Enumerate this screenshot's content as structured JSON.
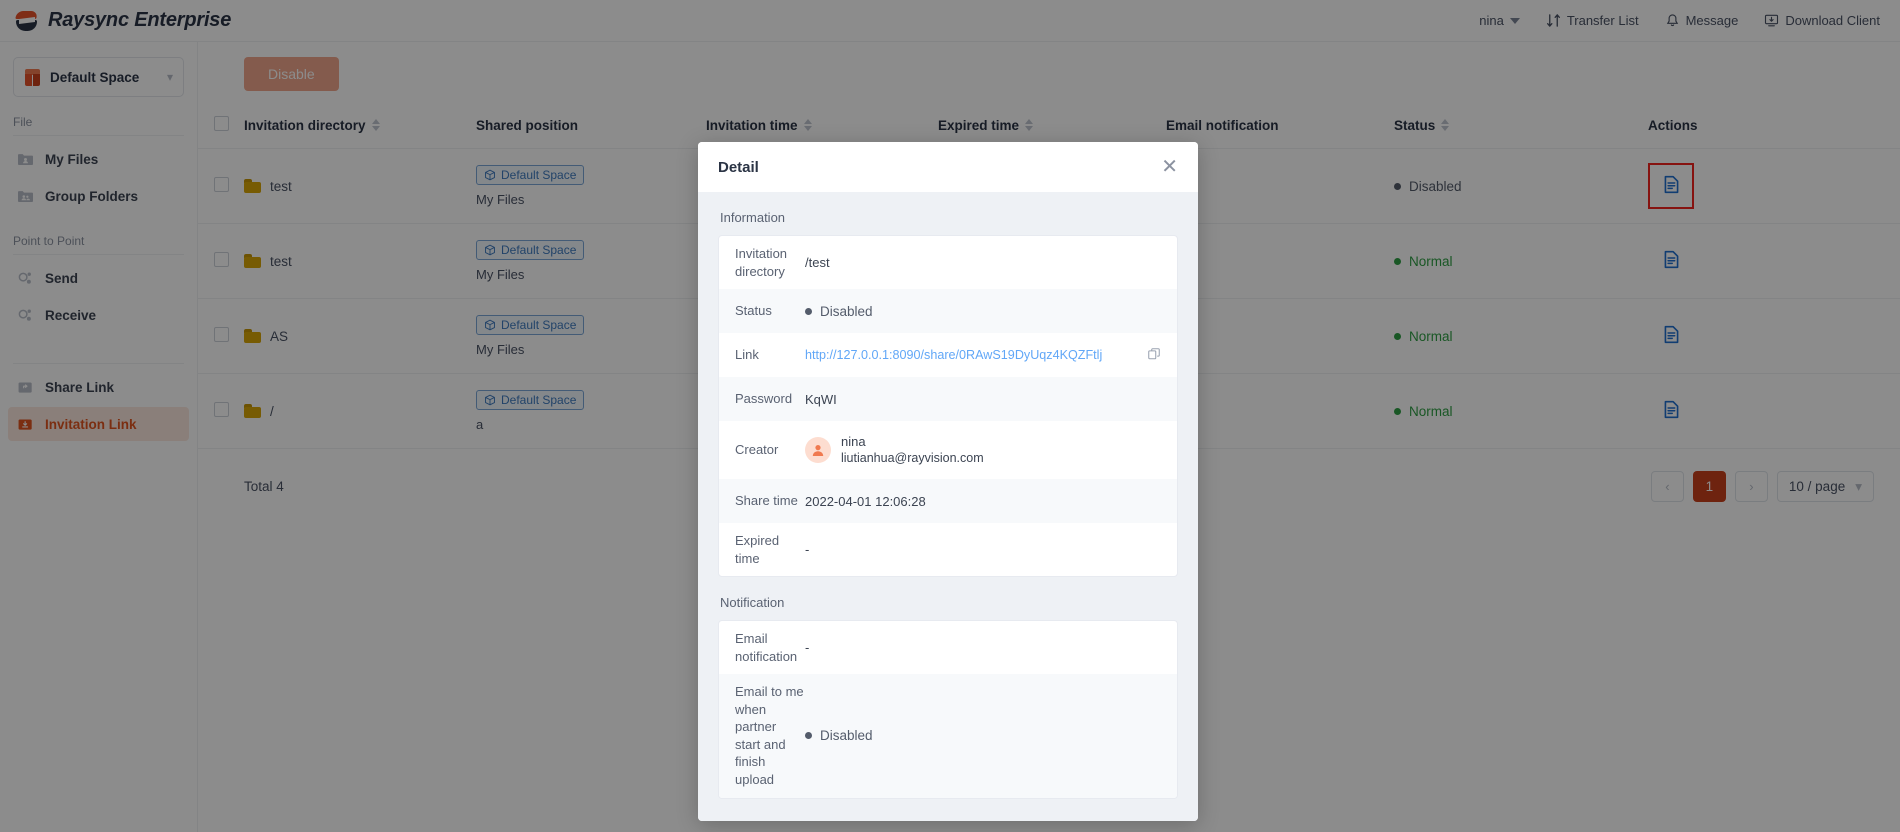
{
  "header": {
    "brand": "Raysync Enterprise",
    "brand_logo_icon": "raysync-logo-icon",
    "user": "nina",
    "user_caret_icon": "chevron-down-icon",
    "transfer_list": "Transfer List",
    "transfer_list_icon": "transfer-icon",
    "message": "Message",
    "message_icon": "bell-icon",
    "download_client": "Download Client",
    "download_client_icon": "monitor-download-icon"
  },
  "sidebar": {
    "space_selector": {
      "label": "Default Space",
      "icon": "cube-icon",
      "chevron": "chevron-down-icon"
    },
    "groups": [
      {
        "title": "File",
        "items": [
          {
            "label": "My Files",
            "icon": "folder-user-icon",
            "active": false
          },
          {
            "label": "Group Folders",
            "icon": "folder-group-icon",
            "active": false
          }
        ]
      },
      {
        "title": "Point to Point",
        "items": [
          {
            "label": "Send",
            "icon": "send-icon",
            "active": false
          },
          {
            "label": "Receive",
            "icon": "receive-icon",
            "active": false
          }
        ]
      },
      {
        "title": "",
        "items": [
          {
            "label": "Share Link",
            "icon": "share-link-icon",
            "active": false
          },
          {
            "label": "Invitation Link",
            "icon": "invitation-link-icon",
            "active": true
          }
        ]
      }
    ]
  },
  "toolbar": {
    "disable_label": "Disable"
  },
  "table": {
    "columns": [
      {
        "label": "Invitation directory",
        "sortable": true
      },
      {
        "label": "Shared position",
        "sortable": false
      },
      {
        "label": "Invitation time",
        "sortable": true
      },
      {
        "label": "Expired time",
        "sortable": true
      },
      {
        "label": "Email notification",
        "sortable": false
      },
      {
        "label": "Status",
        "sortable": true
      },
      {
        "label": "Actions",
        "sortable": false
      }
    ],
    "rows": [
      {
        "directory": "test",
        "space_tag": "Default Space",
        "sub_path": "My Files",
        "invitation_time": "",
        "expired_time": "-",
        "email_notification": "",
        "status": "Disabled",
        "status_kind": "disabled",
        "action_icon": "detail-document-icon",
        "action_highlighted": true
      },
      {
        "directory": "test",
        "space_tag": "Default Space",
        "sub_path": "My Files",
        "invitation_time": "",
        "expired_time": "-",
        "email_notification": "",
        "status": "Normal",
        "status_kind": "normal",
        "action_icon": "detail-document-icon",
        "action_highlighted": false
      },
      {
        "directory": "AS",
        "space_tag": "Default Space",
        "sub_path": "My Files",
        "invitation_time": "",
        "expired_time": "-",
        "email_notification": "",
        "status": "Normal",
        "status_kind": "normal",
        "action_icon": "detail-document-icon",
        "action_highlighted": false
      },
      {
        "directory": "/",
        "space_tag": "Default Space",
        "sub_path": "a",
        "invitation_time": "",
        "expired_time": "-",
        "email_notification": "",
        "status": "Normal",
        "status_kind": "normal",
        "action_icon": "detail-document-icon",
        "action_highlighted": false
      }
    ]
  },
  "footer": {
    "total": "Total 4",
    "prev_icon": "chevron-left-icon",
    "next_icon": "chevron-right-icon",
    "current_page": "1",
    "page_size": "10 / page",
    "page_size_caret": "chevron-down-icon"
  },
  "modal": {
    "title": "Detail",
    "close_icon": "close-icon",
    "sections": [
      {
        "title": "Information",
        "rows": [
          {
            "key": "Invitation directory",
            "value": "/test",
            "kind": "text"
          },
          {
            "key": "Status",
            "value": "Disabled",
            "kind": "status-disabled"
          },
          {
            "key": "Link",
            "value": "http://127.0.0.1:8090/share/0RAwS19DyUqz4KQZFtlj",
            "kind": "link",
            "copy_icon": "copy-icon"
          },
          {
            "key": "Password",
            "value": "KqWI",
            "kind": "text"
          },
          {
            "key": "Creator",
            "value": "nina",
            "value2": "liutianhua@rayvision.com",
            "kind": "user",
            "avatar_icon": "user-avatar-icon"
          },
          {
            "key": "Share time",
            "value": "2022-04-01 12:06:28",
            "kind": "text"
          },
          {
            "key": "Expired time",
            "value": "-",
            "kind": "text"
          }
        ]
      },
      {
        "title": "Notification",
        "rows": [
          {
            "key": "Email notification",
            "value": "-",
            "kind": "text"
          },
          {
            "key": "Email to me when partner start and finish upload",
            "value": "Disabled",
            "kind": "status-disabled"
          }
        ]
      }
    ]
  },
  "colors": {
    "brand_orange": "#e8522a",
    "accent_active_bg": "#fbe7de",
    "link_blue": "#61a7f7",
    "status_normal": "#2f9e44",
    "status_disabled": "#545c6b",
    "highlight_box": "#f4231e"
  }
}
